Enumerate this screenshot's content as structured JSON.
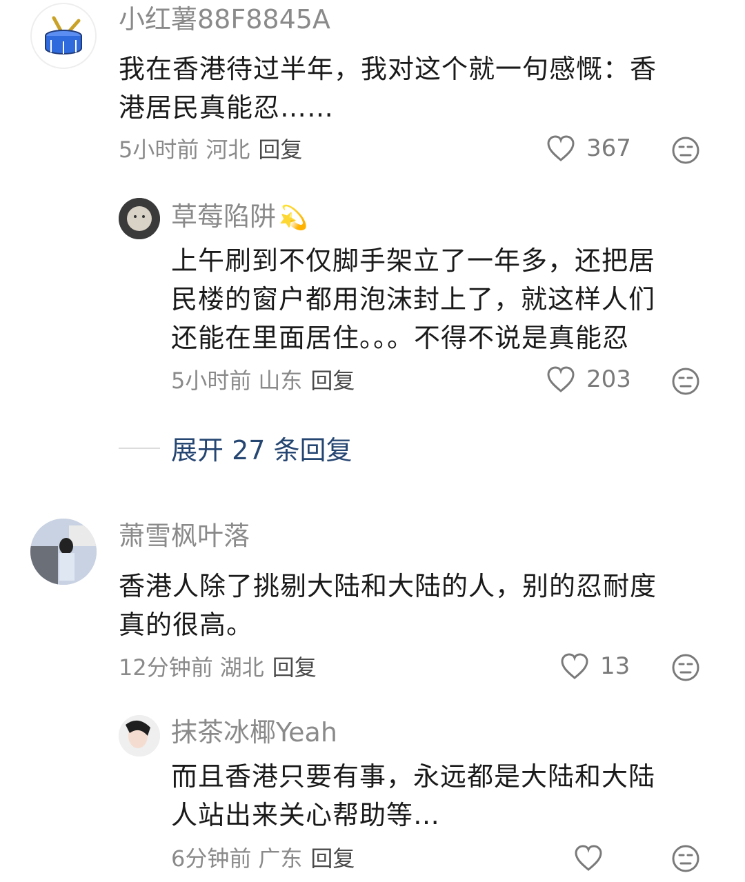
{
  "comments": [
    {
      "user": "小红薯88F8845A",
      "text_line1": "我在香港待过半年，我对这个就一句感慨：香",
      "text_line2": "港居民真能忍……",
      "time": "5小时前",
      "location": "河北",
      "reply_label": "回复",
      "likes": "367"
    },
    {
      "user": "草莓陷阱",
      "user_emoji": "💫",
      "text_line1": "上午刷到不仅脚手架立了一年多，还把居",
      "text_line2": "民楼的窗户都用泡沫封上了，就这样人们",
      "text_line3": "还能在里面居住。。。不得不说是真能忍",
      "time": "5小时前",
      "location": "山东",
      "reply_label": "回复",
      "likes": "203"
    },
    {
      "expand_label": "展开 27 条回复"
    },
    {
      "user": "萧雪枫叶落",
      "text_line1": "香港人除了挑剔大陆和大陆的人，别的忍耐度",
      "text_line2": "真的很高。",
      "time": "12分钟前",
      "location": "湖北",
      "reply_label": "回复",
      "likes": "13"
    },
    {
      "user": "抹茶冰椰Yeah",
      "text_line1": "而且香港只要有事，永远都是大陆和大陆",
      "text_line2": "人站出来关心帮助等…",
      "time": "6分钟前",
      "location": "广东",
      "reply_label": "回复"
    }
  ],
  "icons": {
    "like": "heart-outline-icon",
    "dislike": "neutral-face-icon",
    "avatar_1": "drum-icon"
  },
  "colors": {
    "name": "#8a8a8a",
    "text": "#1a1a1a",
    "expand": "#264672",
    "drum_blue": "#2f6bdc"
  }
}
